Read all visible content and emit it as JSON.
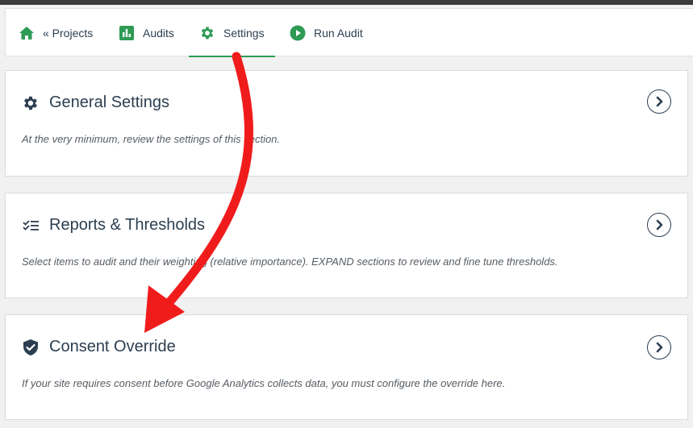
{
  "nav": {
    "items": [
      {
        "label": "« Projects",
        "icon": "home-icon"
      },
      {
        "label": "Audits",
        "icon": "bar-chart-icon"
      },
      {
        "label": "Settings",
        "icon": "gear-icon",
        "active": true
      },
      {
        "label": "Run Audit",
        "icon": "play-circle-icon"
      }
    ]
  },
  "sections": [
    {
      "title": "General Settings",
      "icon": "gear-icon",
      "description": "At the very minimum, review the settings of this section."
    },
    {
      "title": "Reports & Thresholds",
      "icon": "list-check-icon",
      "description": "Select items to audit and their weighting (relative importance). EXPAND sections to review and fine tune thresholds."
    },
    {
      "title": "Consent Override",
      "icon": "shield-check-icon",
      "description": "If your site requires consent before Google Analytics collects data, you must configure the override here."
    }
  ],
  "colors": {
    "accent": "#2e9b55",
    "text": "#2c3e50",
    "annotation_arrow": "#f01c1c"
  }
}
